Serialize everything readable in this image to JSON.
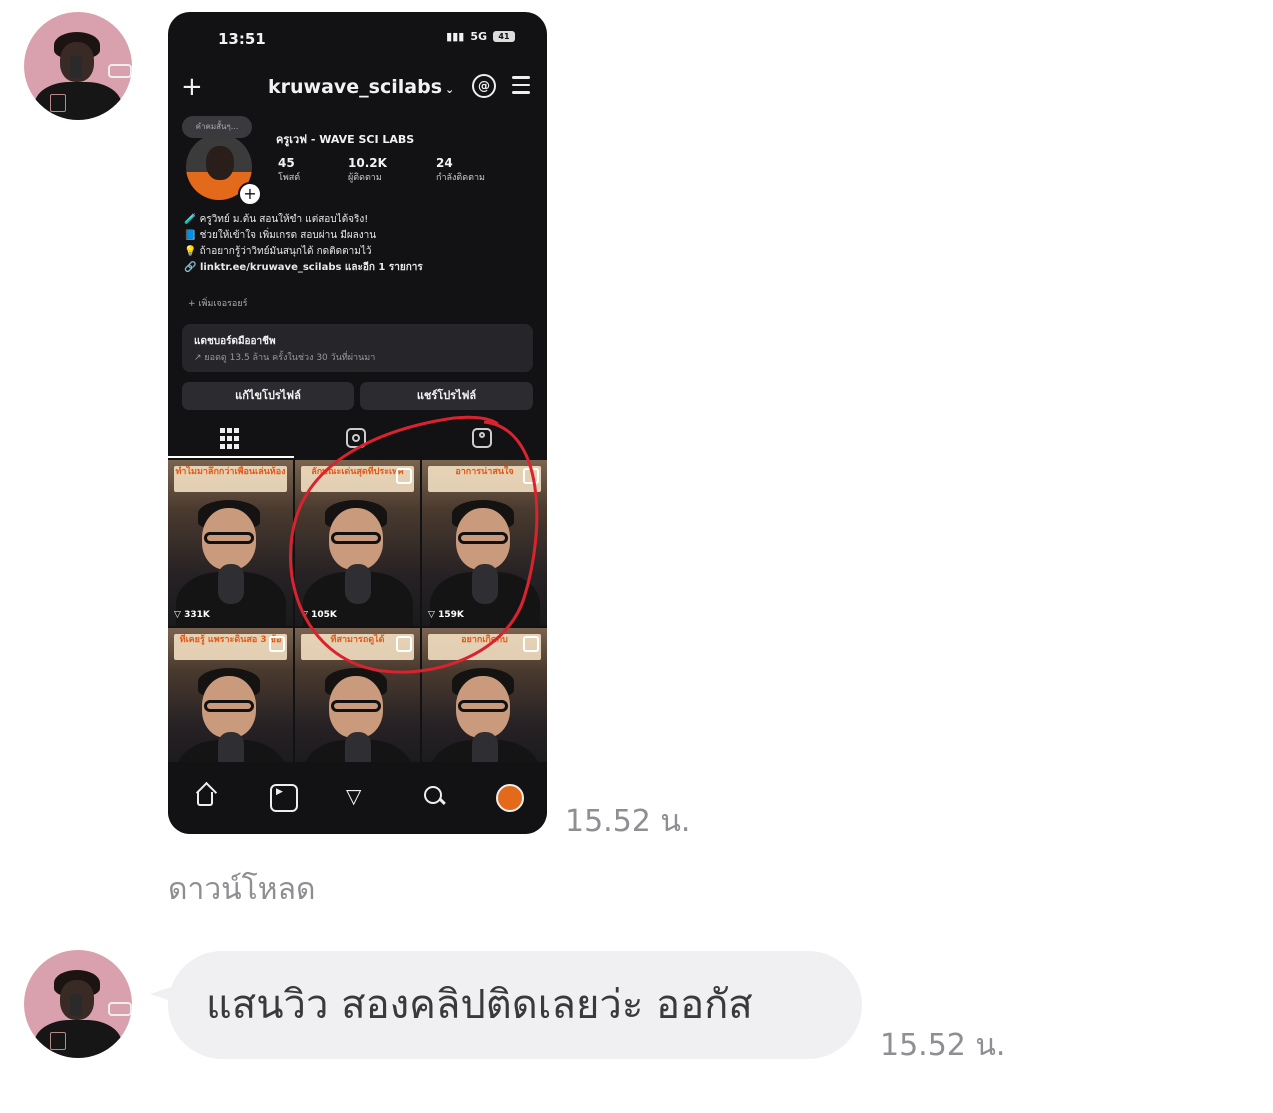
{
  "chat": {
    "image_message": {
      "time": "15.52 น.",
      "download_label": "ดาวน์โหลด"
    },
    "text_message": {
      "text": "แสนวิว สองคลิปติดเลยว่ะ ออกัส",
      "time": "15.52 น."
    }
  },
  "screenshot": {
    "status_time": "13:51",
    "network": "5G",
    "battery": "41",
    "username": "kruwave_scilabs",
    "display_name": "ครูเวฟ - WAVE SCI LABS",
    "note_bubble": "คำคมสั้นๆ...",
    "stats": [
      {
        "value": "45",
        "label": "โพสต์"
      },
      {
        "value": "10.2K",
        "label": "ผู้ติดตาม"
      },
      {
        "value": "24",
        "label": "กำลังติดตาม"
      }
    ],
    "bio_lines": [
      "🧪 ครูวิทย์ ม.ต้น สอนให้ขำ แต่สอบได้จริง!",
      "📘 ช่วยให้เข้าใจ เพิ่มเกรด สอบผ่าน มีผลงาน",
      "💡 ถ้าอยากรู้ว่าวิทย์มันสนุกได้ กดติดตามไว้"
    ],
    "link": "linktr.ee/kruwave_scilabs และอีก 1 รายการ",
    "translation": "+ เพิ่มเจอรอยร์",
    "dashboard_title": "แดชบอร์ดมืออาชีพ",
    "dashboard_sub": "↗ ยอดดู 13.5 ล้าน ครั้งในช่วง 30 วันที่ผ่านมา",
    "btn_edit": "แก้ไขโปรไฟล์",
    "btn_share": "แชร์โปรไฟล์",
    "posts": [
      {
        "caption": "ทำไมมาลึกกว่าเพื่อนเล่นห้อง",
        "views": "331K"
      },
      {
        "caption": "ลักษณะเด่นสุดที่ประเทศ",
        "views": "105K"
      },
      {
        "caption": "อาการน่าสนใจ",
        "views": "159K"
      },
      {
        "caption": "ที่เคยรู้ แพราะดินสอ 3 ข้อ",
        "views": ""
      },
      {
        "caption": "ที่สามารถดูได้",
        "views": ""
      },
      {
        "caption": "อยากเกิดกับ",
        "views": ""
      }
    ]
  }
}
